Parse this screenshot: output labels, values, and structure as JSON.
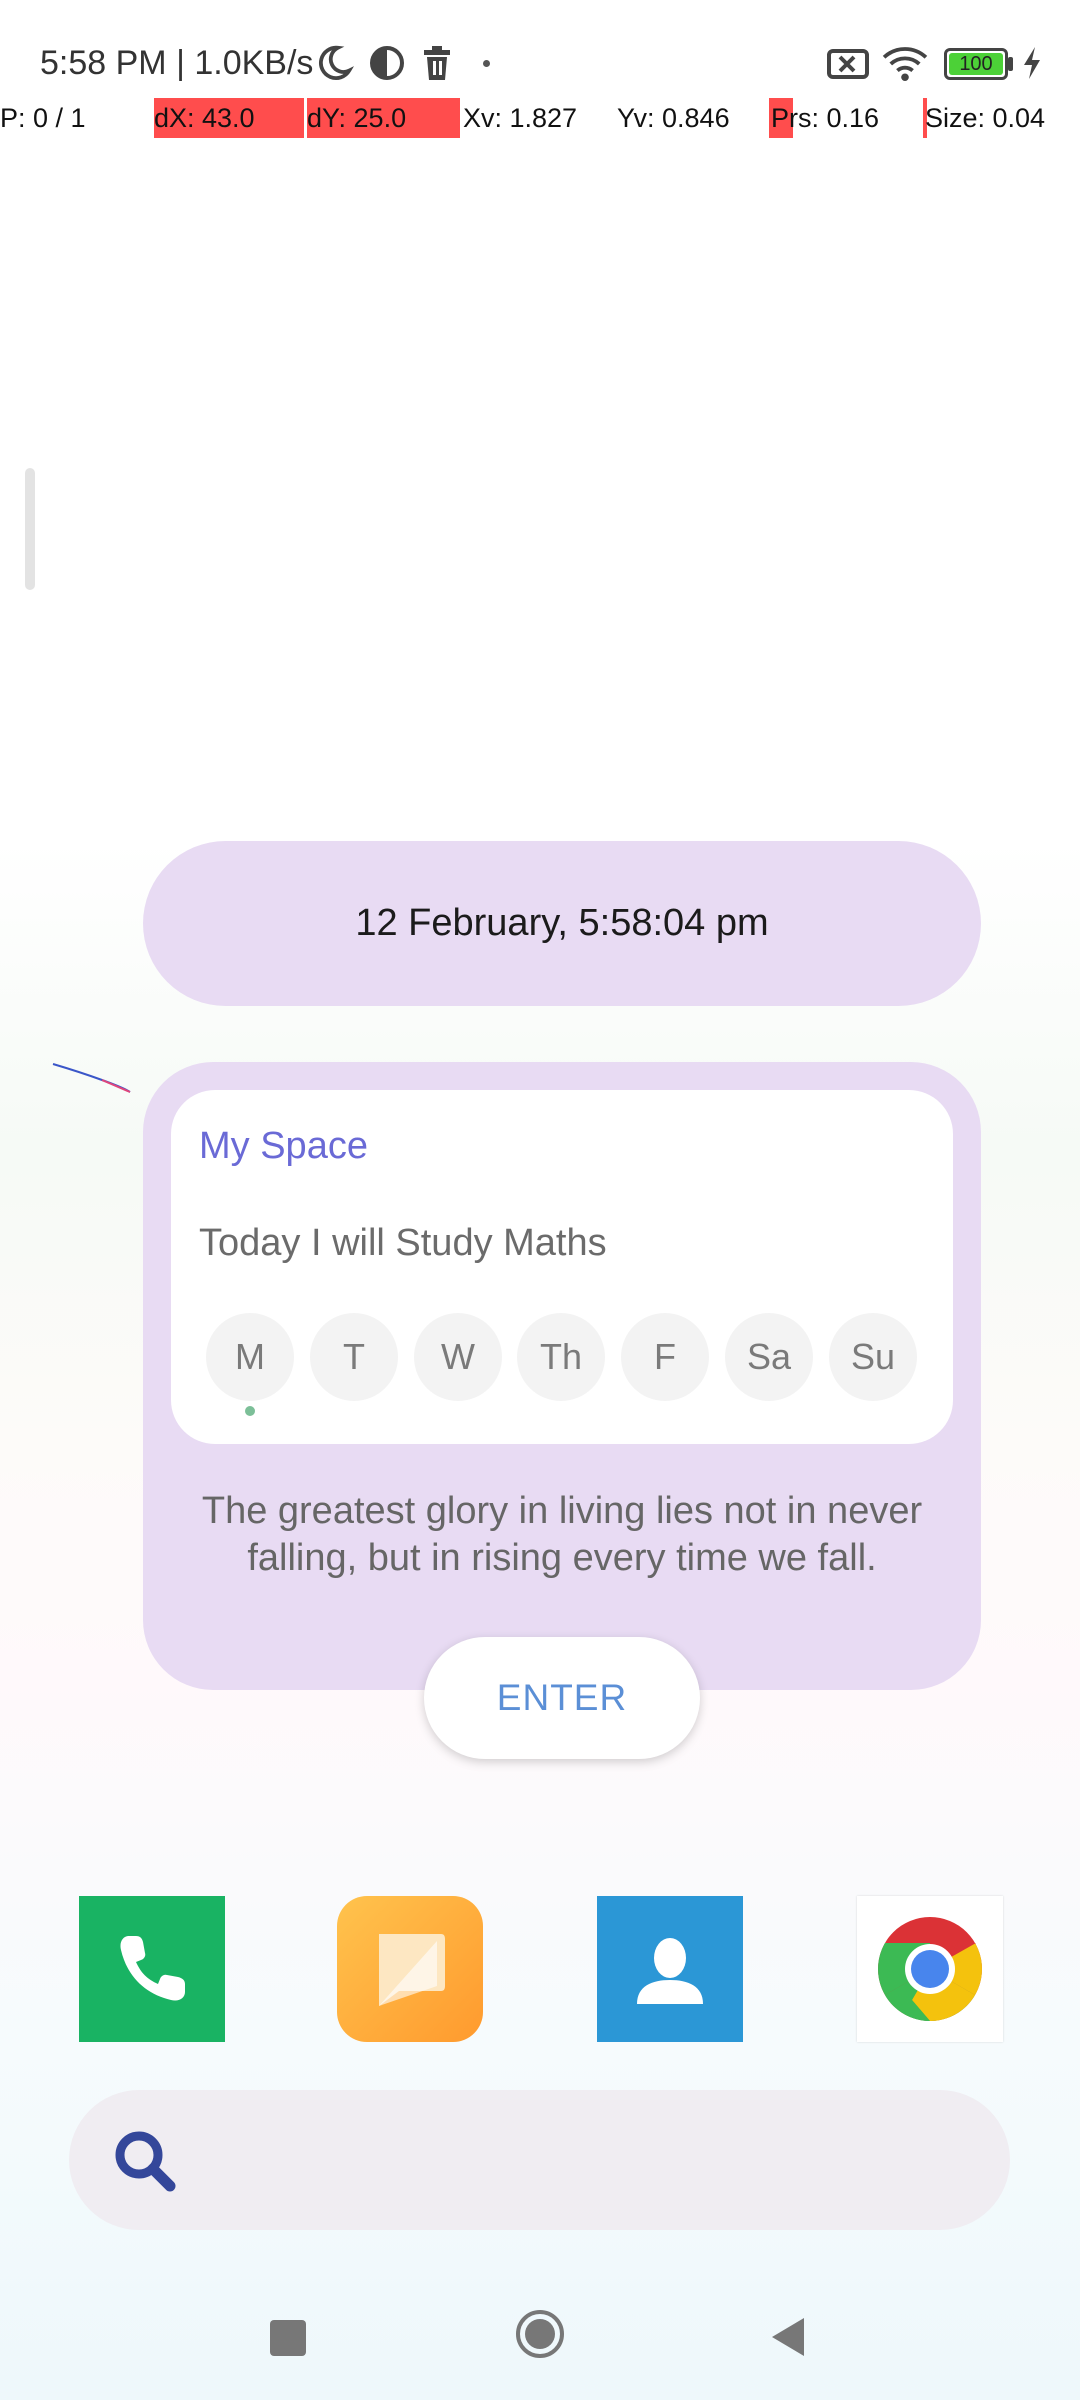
{
  "status_bar": {
    "time_speed": "5:58 PM | 1.0KB/s",
    "battery": "100",
    "icons": [
      "moon-icon",
      "data-saver-icon",
      "trash-icon",
      "dot-icon",
      "sim-x-icon",
      "wifi-icon",
      "battery-icon",
      "charging-bolt-icon"
    ]
  },
  "pointer_info": {
    "pointers": "P: 0 / 1",
    "dx": "dX: 43.0",
    "dy": "dY: 25.0",
    "xv": "Xv: 1.827",
    "yv": "Yv: 0.846",
    "prs": "Prs: 0.16",
    "size": "Size: 0.04"
  },
  "clock_widget": {
    "datetime": "12 February, 5:58:04 pm"
  },
  "my_space": {
    "title": "My Space",
    "task": "Today I will Study Maths",
    "days": [
      "M",
      "T",
      "W",
      "Th",
      "F",
      "Sa",
      "Su"
    ],
    "quote": "The greatest glory in living lies not in never falling, but in rising every time we fall.",
    "enter_label": "ENTER"
  },
  "dock": {
    "apps": [
      "phone-icon",
      "messages-icon",
      "contacts-icon",
      "chrome-icon"
    ]
  },
  "search": {
    "icon": "search-icon"
  },
  "colors": {
    "widget_bg": "#e8dbf3",
    "accent_title": "#6a6ad6",
    "enter_text": "#5b8fd6",
    "phone": "#19b363",
    "contacts": "#2b97d6"
  }
}
